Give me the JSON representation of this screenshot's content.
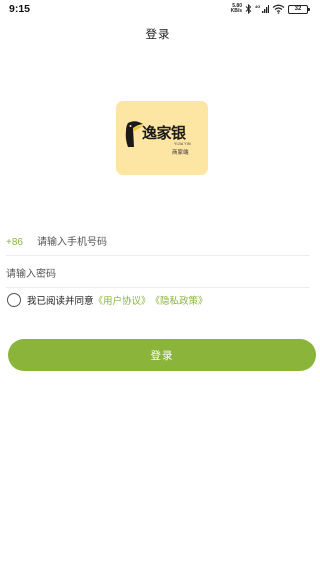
{
  "status_bar": {
    "time": "9:15",
    "net_speed_value": "5.80",
    "net_speed_unit": "KB/s",
    "battery": "32",
    "icons": [
      "bluetooth-icon",
      "signal-icon",
      "wifi-icon",
      "battery-icon"
    ]
  },
  "header": {
    "title": "登录"
  },
  "logo": {
    "name": "逸家银",
    "pinyin": "YIJIA YIN",
    "subtitle": "商家端",
    "background": "#fde5a3"
  },
  "form": {
    "country_code": "+86",
    "phone_placeholder": "请输入手机号码",
    "password_placeholder": "请输入密码",
    "agree_prefix": "我已阅读并同意",
    "user_agreement": "《用户协议》",
    "privacy_policy": "《隐私政策》",
    "login_label": "登录"
  },
  "colors": {
    "accent": "#8ab43a",
    "logo_bg": "#fde5a3",
    "text": "#222222"
  }
}
